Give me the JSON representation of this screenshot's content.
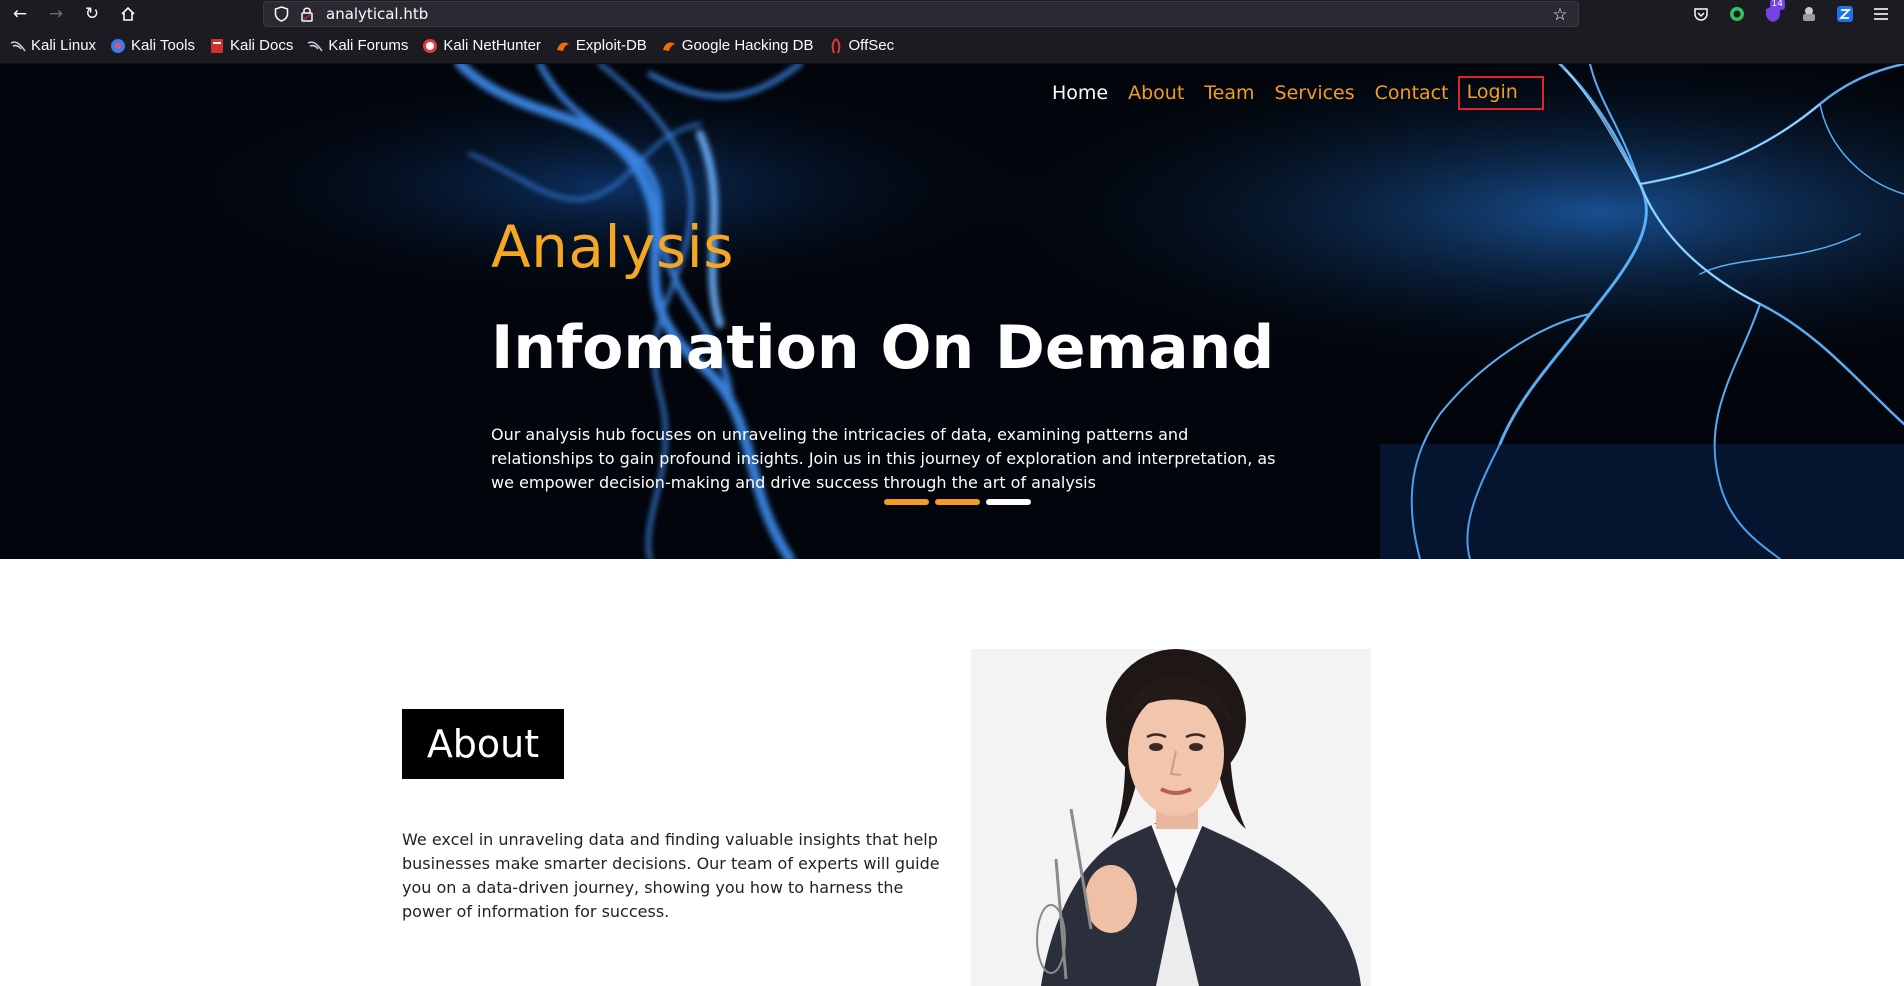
{
  "browser": {
    "url": "analytical.htb",
    "extension_badge": "14",
    "bookmarks": [
      {
        "label": "Kali Linux",
        "icon": "kali-dragon-icon"
      },
      {
        "label": "Kali Tools",
        "icon": "kali-tools-icon"
      },
      {
        "label": "Kali Docs",
        "icon": "kali-docs-icon"
      },
      {
        "label": "Kali Forums",
        "icon": "kali-dragon-icon"
      },
      {
        "label": "Kali NetHunter",
        "icon": "nethunter-icon"
      },
      {
        "label": "Exploit-DB",
        "icon": "exploit-db-icon"
      },
      {
        "label": "Google Hacking DB",
        "icon": "exploit-db-icon"
      },
      {
        "label": "OffSec",
        "icon": "offsec-icon"
      }
    ]
  },
  "nav": {
    "items": [
      {
        "label": "Home"
      },
      {
        "label": "About"
      },
      {
        "label": "Team"
      },
      {
        "label": "Services"
      },
      {
        "label": "Contact"
      },
      {
        "label": "Login"
      }
    ]
  },
  "hero": {
    "subtitle": "Analysis",
    "title": "Infomation On Demand",
    "text": "Our analysis hub focuses on unraveling the intricacies of data, examining patterns and relationships to gain profound insights. Join us in this journey of exploration and interpretation, as we empower decision-making and drive success through the art of analysis",
    "slides_total": 3,
    "active_slide": 3
  },
  "about": {
    "title": "About",
    "text": "We excel in unraveling data and finding valuable insights that help businesses make smarter decisions. Our team of experts will guide you on a data-driven journey, showing you how to harness the power of information for success."
  },
  "colors": {
    "accent": "#f39c1f",
    "browser_bg": "#1c1b22",
    "login_border": "#e0232f"
  }
}
